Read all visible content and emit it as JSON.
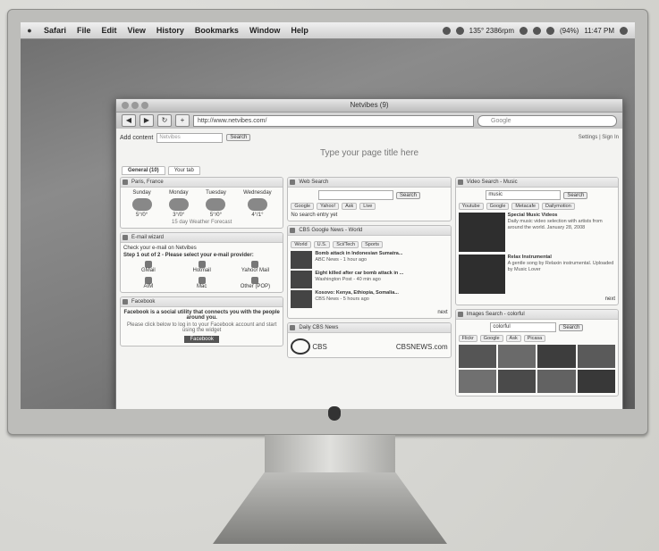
{
  "menubar": {
    "apple": "",
    "items": [
      "Safari",
      "File",
      "Edit",
      "View",
      "History",
      "Bookmarks",
      "Window",
      "Help"
    ],
    "status_temp": "135° 2386rpm",
    "battery": "(94%)",
    "clock": "11:47 PM"
  },
  "browser": {
    "title": "Netvibes (9)",
    "url": "http://www.netvibes.com/",
    "search_placeholder": "Google"
  },
  "page": {
    "add_content": "Add content",
    "search_placeholder": "Netvibes",
    "search_btn": "Search",
    "title": "Type your page title here",
    "top_right": "Settings | Sign In",
    "tabs": [
      "General (10)",
      "Your tab"
    ]
  },
  "widgets": {
    "weather": {
      "title": "Paris, France",
      "days": [
        "Sunday",
        "Monday",
        "Tuesday",
        "Wednesday"
      ],
      "temps": [
        "5°/0°",
        "3°/0°",
        "5°/0°",
        "4°/1°"
      ],
      "footer": "15 day Weather Forecast"
    },
    "mail": {
      "title": "E-mail wizard",
      "line1": "Check your e-mail on Netvibes",
      "line2": "Step 1 out of 2 - Please select your e-mail provider:",
      "providers": [
        "GMail",
        "Hotmail",
        "Yahoo! Mail",
        "AIM",
        "Mac",
        "Other (POP)"
      ]
    },
    "facebook": {
      "title": "Facebook",
      "line1": "Facebook is a social utility that connects you with the people around you.",
      "line2": "Please click below to log in to your Facebook account and start using the widget",
      "button": "Facebook"
    },
    "web_search": {
      "title": "Web Search",
      "button": "Search",
      "engines": [
        "Google",
        "Yahoo!",
        "Ask",
        "Live"
      ],
      "note": "No search entry yet"
    },
    "gnews": {
      "title": "CBS Google News - World",
      "tabs": [
        "World",
        "U.S.",
        "Sci/Tech",
        "Sports"
      ],
      "items": [
        {
          "headline": "Bomb attack in Indonesian Sumatra...",
          "snippet": "ABC News - 1 hour ago"
        },
        {
          "headline": "Eight killed after car bomb attack in ...",
          "snippet": "Washington Post - 40 min ago"
        },
        {
          "headline": "Kosovo: Kenya, Ethiopia, Somalia...",
          "snippet": "CBS News - 5 hours ago"
        }
      ],
      "next": "next"
    },
    "cbs": {
      "title": "Daily CBS News",
      "logo_text": "CBS",
      "text": "CBSNEWS.com"
    },
    "video": {
      "title": "Video Search - Music",
      "query": "music",
      "button": "Search",
      "sources": [
        "Youtube",
        "Google",
        "Metacafe",
        "Dailymotion"
      ],
      "items": [
        {
          "title": "Special Music Videos",
          "text": "Daily music video selection with artists from around the world. January 28, 2008"
        },
        {
          "title": "Relax Instrumental",
          "text": "A gentle song by Relaxin instrumental. Uploaded by Music Lover"
        }
      ],
      "next": "next"
    },
    "images": {
      "title": "Images Search - colorful",
      "query": "colorful",
      "button": "Search",
      "sources": [
        "Flickr",
        "Google",
        "Ask",
        "Picasa"
      ]
    }
  },
  "colors": {
    "screen": "#7a7a7a",
    "bezel": "#bdbdba",
    "page_bg": "#f3f3f1"
  }
}
